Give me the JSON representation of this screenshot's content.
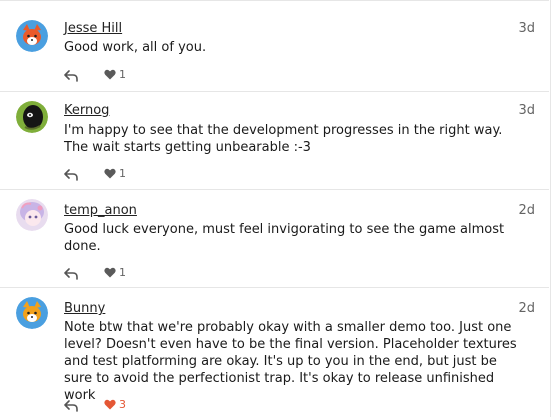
{
  "posts": [
    {
      "username": "Jesse Hill",
      "date": "3d",
      "body": "Good work, all of you.",
      "likes": "1",
      "liked": false,
      "avatar_color": "#4a9fe0"
    },
    {
      "username": "Kernog",
      "date": "3d",
      "body": "I'm happy to see that the development progresses in the right way. The wait starts getting unbearable :-3",
      "likes": "1",
      "liked": false,
      "avatar_color": "#7fae3a"
    },
    {
      "username": "temp_anon",
      "date": "2d",
      "body": "Good luck everyone, must feel invigorating to see the game almost done.",
      "likes": "1",
      "liked": false,
      "avatar_color": "#e8dcef"
    },
    {
      "username": "Bunny",
      "date": "2d",
      "body": "Note btw that we're probably okay with a smaller demo too. Just one level?  Doesn't even have to be the final version. Placeholder textures and test platforming are okay.  It's up to you in the end, but just be sure to avoid the perfectionist trap. It's okay to release unfinished work",
      "likes": "3",
      "liked": true,
      "avatar_color": "#4a9fe0"
    }
  ],
  "colors": {
    "accent_like": "#e45735",
    "muted": "#646464",
    "divider": "#e6e6e6"
  }
}
